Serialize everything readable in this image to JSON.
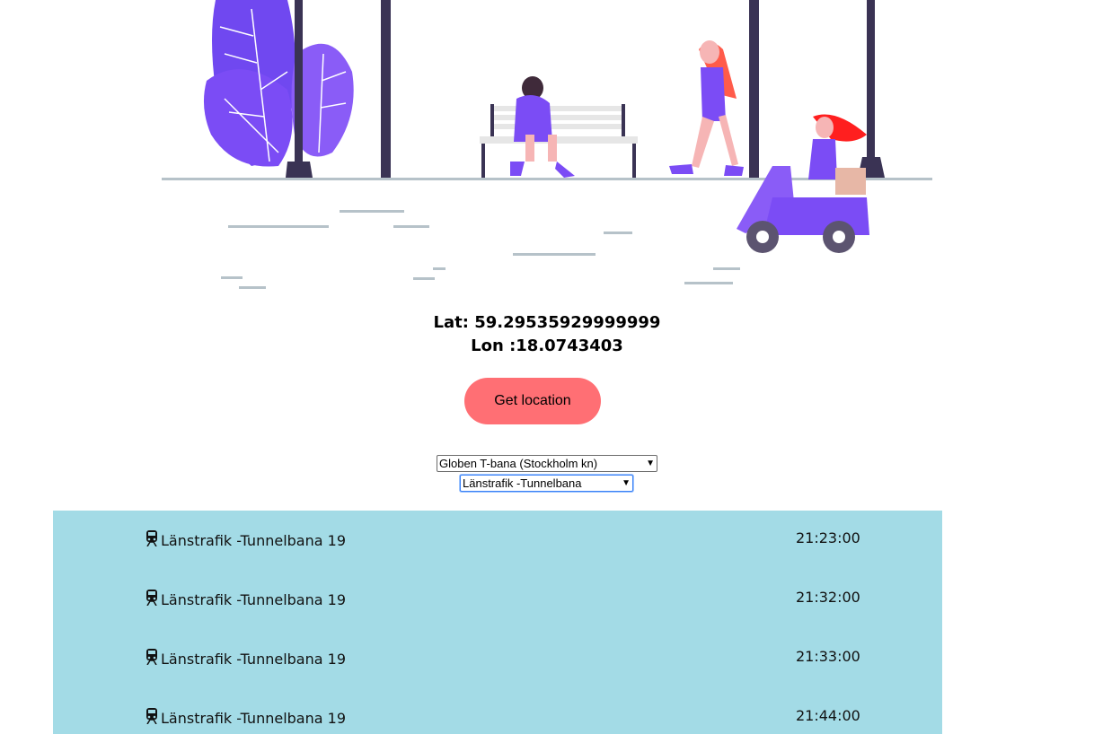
{
  "location": {
    "lat_text": "Lat: 59.29535929999999",
    "lon_text": "Lon :18.0743403",
    "button_label": "Get location"
  },
  "selects": {
    "stop": "Globen T-bana (Stockholm kn)",
    "line": "Länstrafik -Tunnelbana"
  },
  "departures": [
    {
      "name": "Länstrafik -Tunnelbana 19",
      "time": "21:23:00",
      "icon": "train-icon"
    },
    {
      "name": "Länstrafik -Tunnelbana 19",
      "time": "21:32:00",
      "icon": "train-icon"
    },
    {
      "name": "Länstrafik -Tunnelbana 19",
      "time": "21:33:00",
      "icon": "train-icon"
    },
    {
      "name": "Länstrafik -Tunnelbana 19",
      "time": "21:44:00",
      "icon": "train-icon"
    }
  ],
  "colors": {
    "accent_button": "#ff6f74",
    "list_background": "#a3dbe6",
    "illustration_purple": "#7b4cf5"
  }
}
